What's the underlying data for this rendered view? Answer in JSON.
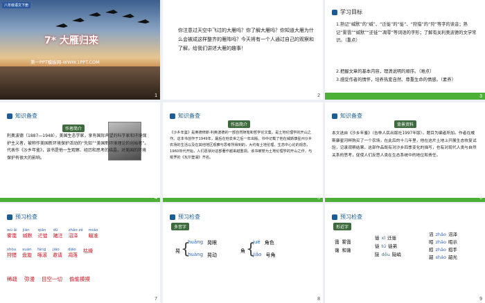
{
  "slides": [
    {
      "num": "1",
      "badge": "八年级语文下册",
      "title": "7* 大雁归来",
      "subtitle": "第一PPT模板网-WWW.1PPT.COM"
    },
    {
      "num": "2",
      "text": "你注意过天空中飞过的大雁吗？你了解大雁吗？你知道大雁为什么会被成这样整齐的雁阵吗？今天将有一个人通过自己的观察和了解，给我们讲述大雁的趣事！"
    },
    {
      "num": "3",
      "heading": "学习目标",
      "lines": [
        "1.熟记“缄默”的“缄”、“迁徙”的“徙”、“狩猎”的“狩”等字的读音；熟记“雾霭”“缄默”“迂徙”“凋零”等词语的字形；了解有关利奥波德的文学常识。（重点）",
        "2.把握文章的基本内容，理清说明的顺序。（难点）",
        "3.感受作者的情怀，培养热爱自然、尊重生命的情感。（素养）"
      ]
    },
    {
      "num": "4",
      "heading": "知识备查",
      "stamp": "作者简介",
      "text": "利奥波德（1887—1948），美国生态学家，享有国际声望的科学家和环境保护主义者，被称作美国新环境保护活动的“先知”“美国新环境理论的创始者”。代表作《沙乡年鉴》，该书是他一生观察、经历和思考的结晶，对美国的环境保护有很大的影响。"
    },
    {
      "num": "5",
      "heading": "知识备查",
      "stamp": "作品简介",
      "text": "《沙乡年鉴》是奥德修斯·利奥波德的一部自然随笔和哲学论文集，是土地伦理学的开山之作。这本书创作于1949年，最后在他去世之后一年出版。书中记载了他在威斯康星州沙乡农场的生活以及在其他地区观察与思考所得到的，大约有土地伦理、生态中心论的观念，1960年代开始，人们逐渐对这部著作越来越重视。该书被誉为土地伦理学的开山之作，与梭罗的《瓦尔登湖》齐名。"
    },
    {
      "num": "6",
      "heading": "知识备查",
      "stamp": "背景资料",
      "text": "本文选自《沙乡年鉴》（吉林人民出版社1997年版）。题目为编者所加。作者在威斯康星河畔购买了一个农场，在此后的十几年里，他在这片土地上开展生态恢复试验，记录观察结果。这部作品既有对沙乡四季变化的描写，也有对现代人类与自然关系的思考，促使人们反思人类在生态系统中的地位和责任。"
    },
    {
      "num": "7",
      "heading": "预习检查",
      "rows": [
        [
          {
            "py": "wù ǎi",
            "w": "雾霭"
          },
          {
            "py": "jiān",
            "w": "缄默"
          },
          {
            "py": "qiān",
            "w": "迁徙"
          },
          {
            "py": "dǔ",
            "w": "赌注"
          },
          {
            "py": "zhǎo zé",
            "w": "沼泽"
          },
          {
            "py": "miáo",
            "w": "瞄准"
          }
        ],
        [
          {
            "py": "shòu",
            "w": "狩猎"
          },
          {
            "py": "xuán",
            "w": "盘旋"
          },
          {
            "py": "fáng",
            "w": "啄滚"
          },
          {
            "py": "jiāo",
            "w": "邀请"
          },
          {
            "py": "diāo",
            "w": "凋落"
          },
          {
            "py": "",
            "w": "枯燥"
          }
        ],
        [
          {
            "py": "",
            "w": "稀疏"
          },
          {
            "py": "",
            "w": "弥漫"
          },
          {
            "py": "",
            "w": "目空一切"
          },
          {
            "py": "",
            "w": "偷偷摸摸"
          }
        ]
      ]
    },
    {
      "num": "8",
      "heading": "预习检查",
      "stamp": "多音字",
      "groups": [
        {
          "char": "晃",
          "items": [
            {
              "py": "huǎng",
              "w": "晃眼"
            },
            {
              "py": "huàng",
              "w": "晃动"
            }
          ]
        },
        {
          "char": "角",
          "items": [
            {
              "py": "jué",
              "w": "角色"
            },
            {
              "py": "jiǎo",
              "w": "号角"
            }
          ]
        }
      ]
    },
    {
      "num": "9",
      "heading": "预习检查",
      "stamp": "形近字",
      "col1": [
        {
          "a": "霭",
          "b": "雾霭"
        },
        {
          "a": "蔼",
          "b": "和蔼"
        }
      ],
      "col2": [
        {
          "a": "徙",
          "py": "xǐ",
          "b": "迁徙"
        },
        {
          "a": "徒",
          "py": "tú",
          "b": "徒弟"
        },
        {
          "a": "陡",
          "py": "dǒu",
          "b": "陡峭"
        }
      ],
      "col3": [
        {
          "a": "沼",
          "py": "zhǎo",
          "b": "沼泽"
        },
        {
          "a": "昭",
          "py": "zhāo",
          "b": "昭示"
        },
        {
          "a": "招",
          "py": "zhāo",
          "b": "招手"
        },
        {
          "a": "韶",
          "py": "sháo",
          "b": "韶光"
        }
      ]
    }
  ]
}
